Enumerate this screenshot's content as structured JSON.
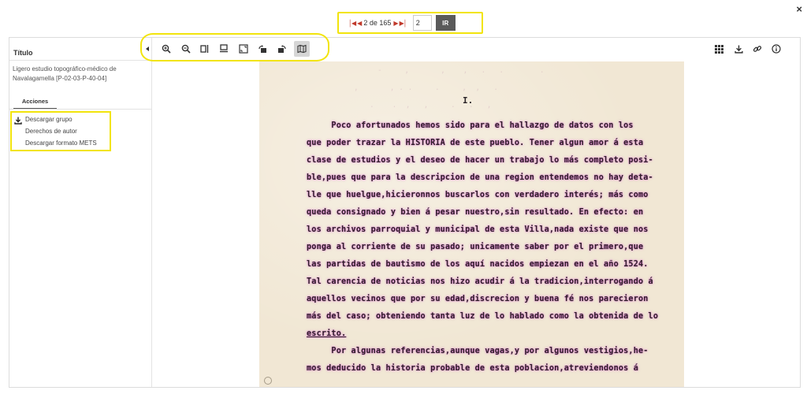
{
  "pagination": {
    "first_icon": "first-page-icon",
    "prev_icon": "prev-page-icon",
    "current_page": "2",
    "of_text": "de",
    "total_pages": "165",
    "next_icon": "next-page-icon",
    "last_icon": "last-page-icon",
    "page_input_value": "2",
    "go_label": "IR"
  },
  "sidebar": {
    "title": "Título",
    "description": "Ligero estudio topográfico-médico de Navalagamella [P-02-03-P-40-04]",
    "tab_label": "Acciones",
    "actions": [
      {
        "label": "Descargar grupo",
        "icon": "download-icon"
      },
      {
        "label": "Derechos de autor"
      },
      {
        "label": "Descargar formato METS"
      }
    ]
  },
  "toolbar": {
    "left": [
      "collapse-sidebar-icon",
      "zoom-in-icon",
      "zoom-out-icon",
      "fit-width-icon",
      "fit-height-icon",
      "fullscreen-icon",
      "rotate-left-icon",
      "rotate-right-icon",
      "map-icon"
    ],
    "right": [
      "grid-view-icon",
      "download-icon",
      "link-icon",
      "info-icon"
    ]
  },
  "close_icon": "×",
  "document": {
    "heading": "I.",
    "lines": [
      "     Poco afortunados hemos sido para el hallazgo de datos con los",
      "que poder trazar la HISTORIA de este pueblo. Tener algun amor á esta",
      "clase de estudios y el deseo de hacer un trabajo lo más completo posi-",
      "ble,pues que para la descripcion de una region entendemos no hay deta-",
      "lle que huelgue,hicieronnos buscarlos con verdadero interés; más como",
      "queda consignado y bien á pesar nuestro,sin resultado. En efecto: en",
      "los archivos parroquial y municipal de esta Villa,nada existe que nos",
      "ponga al corriente de su pasado; unicamente saber por el primero,que",
      "las partidas de bautismo de los aquí nacidos empiezan en el año 1524.",
      "Tal carencia de noticias nos hizo acudir á la tradicion,interrogando á",
      "aquellos vecinos que por su edad,discrecion y buena fé nos parecieron",
      "más del caso; obteniendo tanta luz de lo hablado como la obtenida de lo",
      "escrito.",
      "     Por algunas referencias,aunque vagas,y por algunos vestigios,he-",
      "mos deducido la historia probable de esta poblacion,atreviendonos á"
    ]
  },
  "colors": {
    "highlight": "#f2e40c",
    "paper": "#f1e7d4",
    "ink_glow": "#cd46c8",
    "nav_red": "#c0392b",
    "go_button": "#5a5a5a"
  }
}
